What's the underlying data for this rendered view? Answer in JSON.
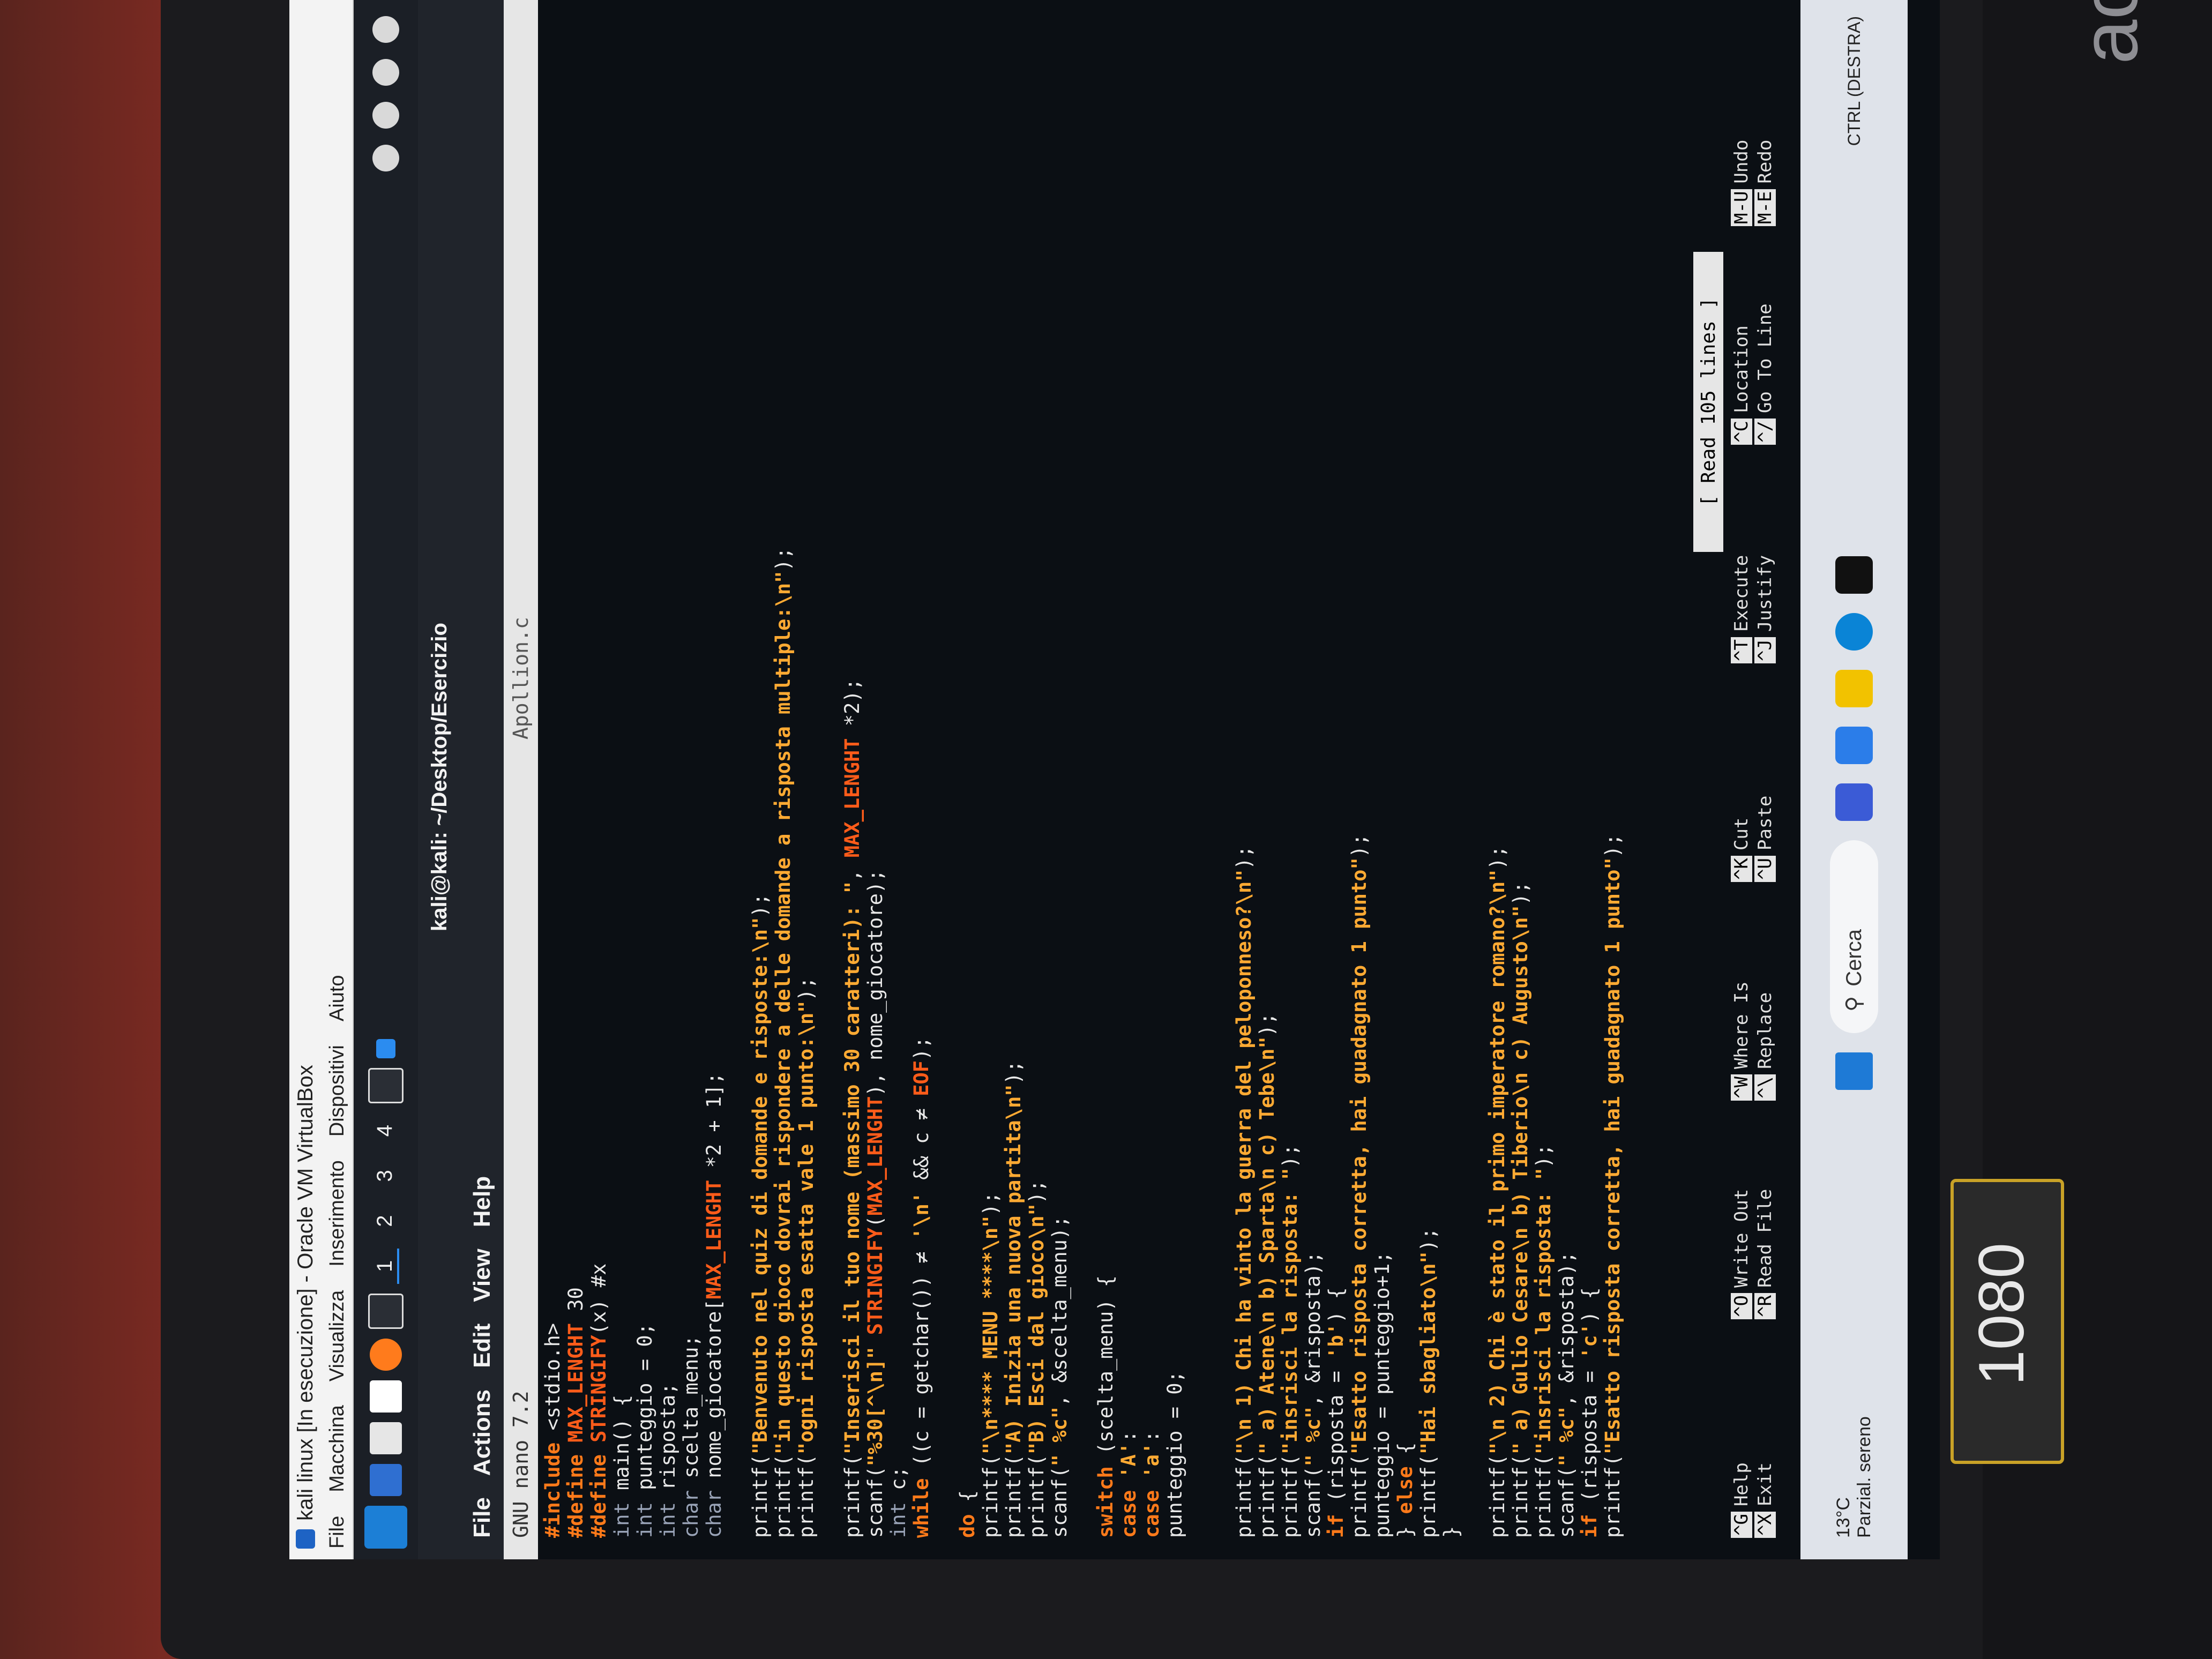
{
  "vbox": {
    "title": "kali linux [In esecuzione] - Oracle VM VirtualBox",
    "menu": [
      "File",
      "Macchina",
      "Visualizza",
      "Inserimento",
      "Dispositivi",
      "Aiuto"
    ]
  },
  "kali_panel": {
    "workspaces": [
      "1",
      "2",
      "3",
      "4"
    ],
    "active_workspace": "1"
  },
  "terminal": {
    "title": "kali@kali: ~/Desktop/Esercizio",
    "menu": [
      "File",
      "Actions",
      "Edit",
      "View",
      "Help"
    ]
  },
  "nano": {
    "version": "GNU nano 7.2",
    "file": "Apollion.c",
    "status": "[ Read 105 lines ]",
    "shortcuts": [
      {
        "key": "^G",
        "label": "Help"
      },
      {
        "key": "^X",
        "label": "Exit"
      },
      {
        "key": "^O",
        "label": "Write Out"
      },
      {
        "key": "^R",
        "label": "Read File"
      },
      {
        "key": "^W",
        "label": "Where Is"
      },
      {
        "key": "^\\",
        "label": "Replace"
      },
      {
        "key": "^K",
        "label": "Cut"
      },
      {
        "key": "^U",
        "label": "Paste"
      },
      {
        "key": "^T",
        "label": "Execute"
      },
      {
        "key": "^J",
        "label": "Justify"
      },
      {
        "key": "^C",
        "label": "Location"
      },
      {
        "key": "^/",
        "label": "Go To Line"
      },
      {
        "key": "M-U",
        "label": "Undo"
      },
      {
        "key": "M-E",
        "label": "Redo"
      }
    ]
  },
  "code": [
    "#include <stdio.h>",
    "#define MAX_LENGHT 30",
    "#define STRINGIFY(x) #x",
    "int main() {",
    "int punteggio = 0;",
    "int risposta;",
    "char scelta_menu;",
    "char nome_giocatore[MAX_LENGHT *2 + 1];",
    "",
    "printf(\"Benvenuto nel quiz di domande e risposte:\\n\");",
    "printf(\"in questo gioco dovrai rispondere a delle domande a risposta multiple:\\n\");",
    "printf(\"ogni risposta esatta vale 1 punto:\\n\");",
    "",
    "printf(\"Inserisci il tuo nome (massimo 30 caratteri): \", MAX_LENGHT *2);",
    "scanf(\"%30[^\\n]\" STRINGIFY(MAX_LENGHT), nome_giocatore);",
    "int c;",
    "while ((c = getchar()) ≠ '\\n' && c ≠ EOF);",
    "",
    "do {",
    "printf(\"\\n**** MENU ****\\n\");",
    "printf(\"A) Inizia una nuova partita\\n\");",
    "printf(\"B) Esci dal gioco\\n\");",
    "scanf(\" %c\", &scelta_menu);",
    "",
    "switch (scelta_menu) {",
    "case 'A':",
    "case 'a':",
    "punteggio = 0;",
    "",
    "",
    "printf(\"\\n 1) Chi ha vinto la guerra del peloponneso?\\n\");",
    "printf(\" a) Atene\\n b) Sparta\\n c) Tebe\\n\");",
    "printf(\"insrisci la risposta: \");",
    "scanf(\" %c\", &risposta);",
    "if (risposta = 'b') {",
    "printf(\"Esatto risposta corretta, hai guadagnato 1 punto\");",
    "punteggio = punteggio+1;",
    "} else {",
    "printf(\"Hai sbagliato\\n\");",
    "}",
    "",
    "printf(\"\\n 2) Chi è stato il primo imperatore romano?\\n\");",
    "printf(\" a) Gulio Cesare\\n b) Tiberio\\n c) Augusto\\n\");",
    "printf(\"insrisci la risposta: \");",
    "scanf(\" %c\", &risposta);",
    "if (risposta = 'c') {",
    "printf(\"Esatto risposta corretta, hai guadagnato 1 punto\");"
  ],
  "windows_taskbar": {
    "weather_temp": "13°C",
    "weather_desc": "Parzial. sereno",
    "search_label": "Cerca",
    "host_key": "CTRL (DESTRA)"
  },
  "hardware": {
    "brand": "acer",
    "sticker": "1080"
  },
  "colors": {
    "editor_bg": "#0b0f14",
    "keyword": "#ff7a1a",
    "string": "#ffaa33",
    "taskbar": "#dfe3ea"
  }
}
